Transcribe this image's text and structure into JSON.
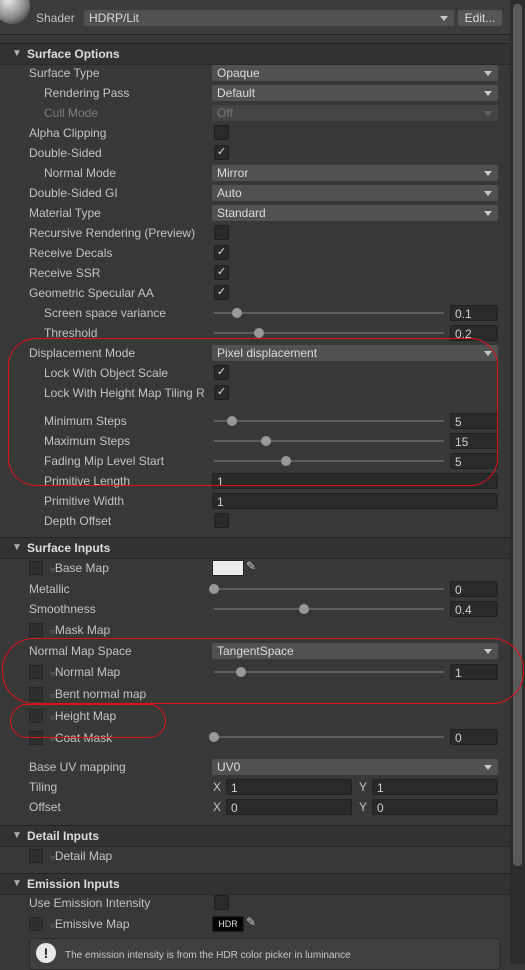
{
  "shader": {
    "label": "Shader",
    "value": "HDRP/Lit",
    "edit": "Edit..."
  },
  "surface_options": {
    "title": "Surface Options",
    "surface_type": {
      "label": "Surface Type",
      "value": "Opaque"
    },
    "rendering_pass": {
      "label": "Rendering Pass",
      "value": "Default"
    },
    "cull_mode": {
      "label": "Cull Mode",
      "value": "Off"
    },
    "alpha_clipping": {
      "label": "Alpha Clipping"
    },
    "double_sided": {
      "label": "Double-Sided"
    },
    "normal_mode": {
      "label": "Normal Mode",
      "value": "Mirror"
    },
    "double_sided_gi": {
      "label": "Double-Sided GI",
      "value": "Auto"
    },
    "material_type": {
      "label": "Material Type",
      "value": "Standard"
    },
    "recursive_rendering": {
      "label": "Recursive Rendering (Preview)"
    },
    "receive_decals": {
      "label": "Receive Decals"
    },
    "receive_ssr": {
      "label": "Receive SSR"
    },
    "geometric_specular_aa": {
      "label": "Geometric Specular AA"
    },
    "screen_space_variance": {
      "label": "Screen space variance",
      "value": "0.1",
      "level": 0.1
    },
    "threshold": {
      "label": "Threshold",
      "value": "0.2",
      "level": 0.2
    },
    "displacement_mode": {
      "label": "Displacement Mode",
      "value": "Pixel displacement"
    },
    "lock_object_scale": {
      "label": "Lock With Object Scale"
    },
    "lock_height_tiling": {
      "label": "Lock With Height Map Tiling R"
    },
    "minimum_steps": {
      "label": "Minimum Steps",
      "value": "5",
      "level": 0.08
    },
    "maximum_steps": {
      "label": "Maximum Steps",
      "value": "15",
      "level": 0.23
    },
    "fading_mip": {
      "label": "Fading Mip Level Start",
      "value": "5",
      "level": 0.32
    },
    "primitive_length": {
      "label": "Primitive Length",
      "value": "1"
    },
    "primitive_width": {
      "label": "Primitive Width",
      "value": "1"
    },
    "depth_offset": {
      "label": "Depth Offset"
    }
  },
  "surface_inputs": {
    "title": "Surface Inputs",
    "base_map": {
      "label": "Base Map"
    },
    "metallic": {
      "label": "Metallic",
      "value": "0",
      "level": 0
    },
    "smoothness": {
      "label": "Smoothness",
      "value": "0.4",
      "level": 0.4
    },
    "mask_map": {
      "label": "Mask Map"
    },
    "normal_map_space": {
      "label": "Normal Map Space",
      "value": "TangentSpace"
    },
    "normal_map": {
      "label": "Normal Map",
      "value": "1",
      "level": 0.12
    },
    "bent_normal_map": {
      "label": "Bent normal map"
    },
    "height_map": {
      "label": "Height Map"
    },
    "coat_mask": {
      "label": "Coat Mask",
      "value": "0",
      "level": 0
    },
    "base_uv_mapping": {
      "label": "Base UV mapping",
      "value": "UV0"
    },
    "tiling": {
      "label": "Tiling",
      "x_label": "X",
      "x": "1",
      "y_label": "Y",
      "y": "1"
    },
    "offset": {
      "label": "Offset",
      "x_label": "X",
      "x": "0",
      "y_label": "Y",
      "y": "0"
    }
  },
  "detail_inputs": {
    "title": "Detail Inputs",
    "detail_map": {
      "label": "Detail Map"
    }
  },
  "emission_inputs": {
    "title": "Emission Inputs",
    "use_emission_intensity": {
      "label": "Use Emission Intensity"
    },
    "emissive_map": {
      "label": "Emissive Map",
      "swatch": "HDR"
    },
    "info": "The emission intensity is from the HDR color picker in luminance"
  }
}
